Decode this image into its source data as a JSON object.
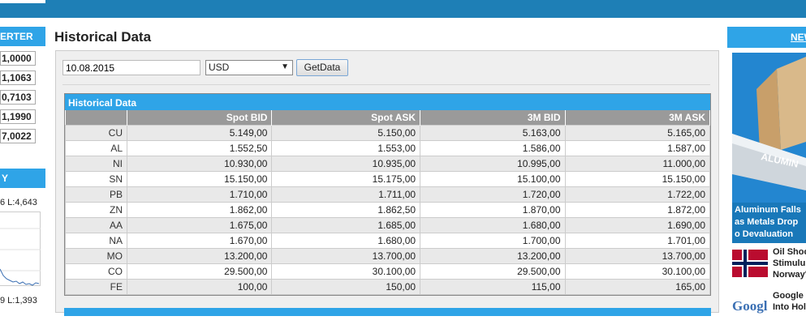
{
  "page": {
    "title": "Historical Data"
  },
  "left": {
    "converter_header": "ERTER",
    "converter_values": [
      "1,0000",
      "1,1063",
      "0,7103",
      "1,1990",
      "7,0022"
    ],
    "section2_header": "Y",
    "chart_label_top": "6 L:4,643",
    "chart_label_bottom": "9 L:1,393"
  },
  "form": {
    "date_value": "10.08.2015",
    "currency": "USD",
    "button_label": "GetData"
  },
  "table": {
    "title": "Historical Data",
    "columns": [
      "",
      "Spot BID",
      "Spot ASK",
      "3M BID",
      "3M ASK"
    ],
    "rows": [
      {
        "metal": "CU",
        "spot_bid": "5.149,00",
        "spot_ask": "5.150,00",
        "m3_bid": "5.163,00",
        "m3_ask": "5.165,00"
      },
      {
        "metal": "AL",
        "spot_bid": "1.552,50",
        "spot_ask": "1.553,00",
        "m3_bid": "1.586,00",
        "m3_ask": "1.587,00"
      },
      {
        "metal": "NI",
        "spot_bid": "10.930,00",
        "spot_ask": "10.935,00",
        "m3_bid": "10.995,00",
        "m3_ask": "11.000,00"
      },
      {
        "metal": "SN",
        "spot_bid": "15.150,00",
        "spot_ask": "15.175,00",
        "m3_bid": "15.100,00",
        "m3_ask": "15.150,00"
      },
      {
        "metal": "PB",
        "spot_bid": "1.710,00",
        "spot_ask": "1.711,00",
        "m3_bid": "1.720,00",
        "m3_ask": "1.722,00"
      },
      {
        "metal": "ZN",
        "spot_bid": "1.862,00",
        "spot_ask": "1.862,50",
        "m3_bid": "1.870,00",
        "m3_ask": "1.872,00"
      },
      {
        "metal": "AA",
        "spot_bid": "1.675,00",
        "spot_ask": "1.685,00",
        "m3_bid": "1.680,00",
        "m3_ask": "1.690,00"
      },
      {
        "metal": "NA",
        "spot_bid": "1.670,00",
        "spot_ask": "1.680,00",
        "m3_bid": "1.700,00",
        "m3_ask": "1.701,00"
      },
      {
        "metal": "MO",
        "spot_bid": "13.200,00",
        "spot_ask": "13.700,00",
        "m3_bid": "13.200,00",
        "m3_ask": "13.700,00"
      },
      {
        "metal": "CO",
        "spot_bid": "29.500,00",
        "spot_ask": "30.100,00",
        "m3_bid": "29.500,00",
        "m3_ask": "30.100,00"
      },
      {
        "metal": "FE",
        "spot_bid": "100,00",
        "spot_ask": "150,00",
        "m3_bid": "115,00",
        "m3_ask": "165,00"
      }
    ]
  },
  "right": {
    "news_header": "NEW",
    "featured_image_text": "ALUMIN",
    "featured_caption": "Aluminum Falls as Metals Drop o Devaluation",
    "items": [
      {
        "line1": "Oil Shoc",
        "line2": "Stimulu",
        "line3": "Norway'"
      },
      {
        "line1": "Google",
        "line2": "Into Hol",
        "thumb_text": "Googl"
      }
    ]
  },
  "colors": {
    "topbar": "#1e7fb6",
    "accent": "#2fa4e7",
    "table_header": "#9a9a9a"
  }
}
